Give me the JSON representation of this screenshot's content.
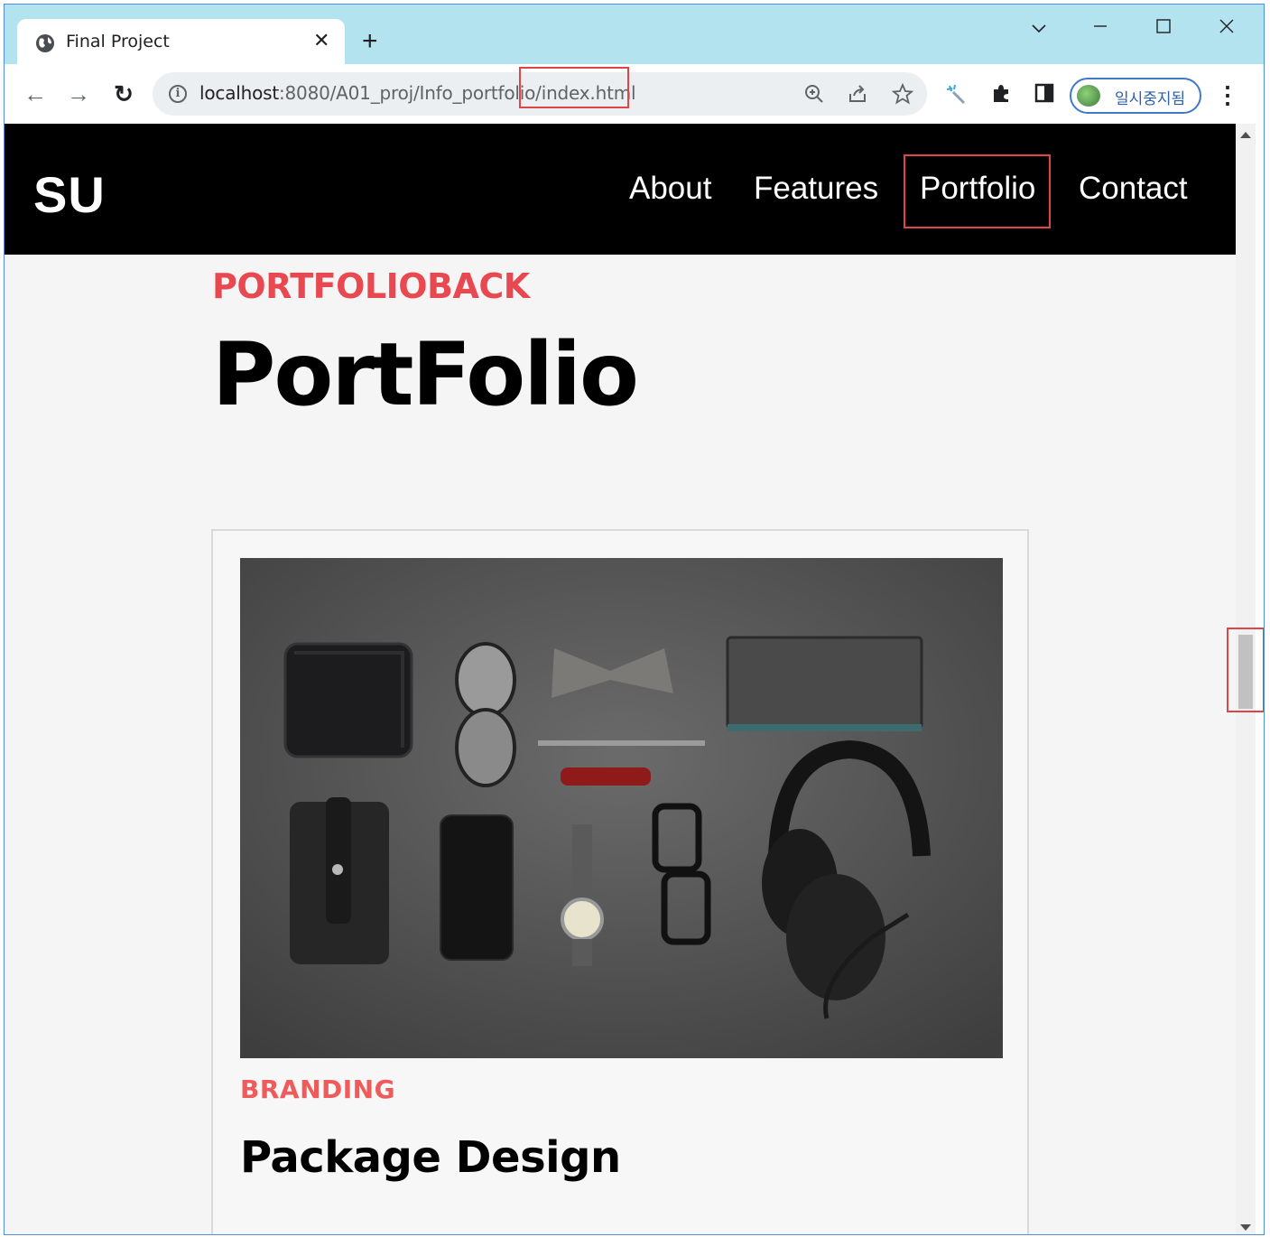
{
  "browser": {
    "tab_title": "Final Project",
    "tab_close": "✕",
    "new_tab": "+",
    "url_host": "localhost",
    "url_path": ":8080/A01_proj/Info_portfolio/index.html",
    "profile_label": "일시중지됨",
    "window_controls": {
      "dropdown": "﹀",
      "minimize": "─",
      "maximize": "☐",
      "close": "✕"
    },
    "nav": {
      "back": "←",
      "forward": "→",
      "reload": "↻"
    },
    "icons": [
      "globe-icon",
      "info-icon",
      "zoom-icon",
      "share-icon",
      "star-icon",
      "extension-sparkle-icon",
      "puzzle-icon",
      "side-panel-icon",
      "menu-kebab-icon"
    ]
  },
  "site": {
    "brand": "SU",
    "nav_links": [
      "About",
      "Features",
      "Portfolio",
      "Contact"
    ],
    "active_link": "Portfolio",
    "eyebrow": "PORTFOLIOBACK",
    "title": "PortFolio",
    "card": {
      "category": "BRANDING",
      "title": "Package Design",
      "image_alt": "flat lay of wallet, sunglasses, bow tie, notebook, pen, phone case, phone, watch, glasses and headphones"
    }
  },
  "colors": {
    "tabstrip": "#b3e3ef",
    "accent_red": "#e8484f",
    "annotation_red": "#e04545",
    "nav_bg": "#000000",
    "page_bg": "#f5f5f5"
  }
}
